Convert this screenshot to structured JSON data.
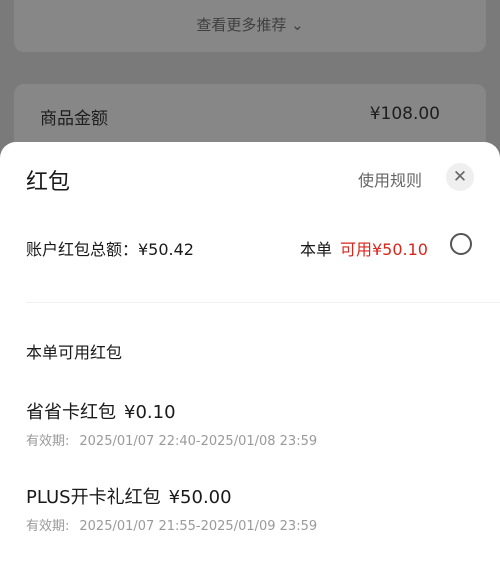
{
  "background": {
    "see_more": "查看更多推荐",
    "see_more_icon": "chevron-down-icon",
    "amount_label": "商品金额",
    "amount_value": "¥108.00"
  },
  "sheet": {
    "title": "红包",
    "rules_link": "使用规则",
    "close_icon": "close-icon",
    "total_label": "账户红包总额：¥50.42",
    "order_prefix": "本单",
    "order_available": "可用¥50.10",
    "section_title": "本单可用红包",
    "items": [
      {
        "name": "省省卡红包",
        "amount": "¥0.10",
        "valid_label": "有效期:",
        "valid_range": "2025/01/07 22:40-2025/01/08 23:59"
      },
      {
        "name": "PLUS开卡礼红包",
        "amount": "¥50.00",
        "valid_label": "有效期:",
        "valid_range": "2025/01/07 21:55-2025/01/09 23:59"
      }
    ]
  },
  "colors": {
    "accent_red": "#d9261c"
  }
}
